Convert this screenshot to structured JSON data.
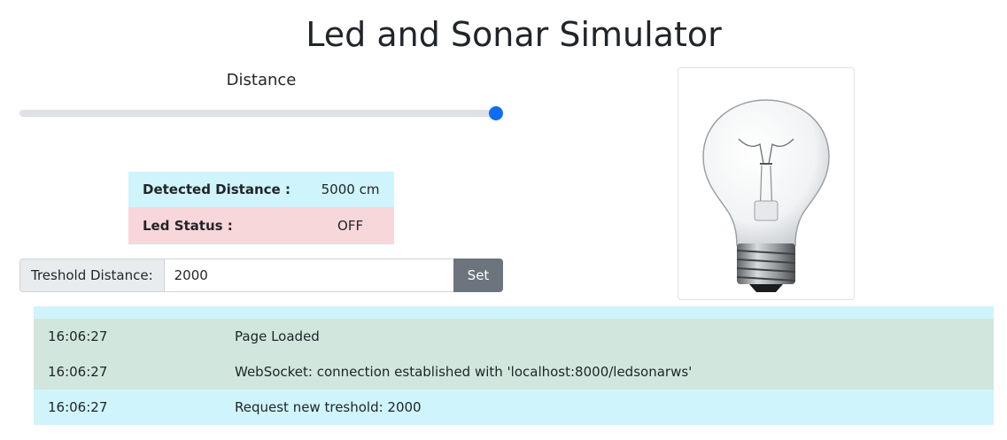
{
  "title": "Led and Sonar Simulator",
  "distance": {
    "label": "Distance",
    "value_fraction": 1.0
  },
  "status": {
    "detected_label": "Detected Distance :",
    "detected_value": "5000 cm",
    "led_label": "Led Status :",
    "led_value": "OFF"
  },
  "threshold": {
    "label": "Treshold Distance:",
    "value": "2000",
    "button": "Set"
  },
  "bulb": {
    "icon": "light-bulb-icon"
  },
  "log": [
    {
      "time": "",
      "message": "",
      "variant": "info"
    },
    {
      "time": "16:06:27",
      "message": "Page Loaded",
      "variant": "success"
    },
    {
      "time": "16:06:27",
      "message": "WebSocket: connection established with 'localhost:8000/ledsonarws'",
      "variant": "success"
    },
    {
      "time": "16:06:27",
      "message": "Request new treshold: 2000",
      "variant": "info"
    }
  ],
  "colors": {
    "accent": "#0d6efd",
    "info": "#cff4fc",
    "success": "#d1e7dd",
    "danger": "#f8d7da",
    "secondary": "#6c757d"
  }
}
